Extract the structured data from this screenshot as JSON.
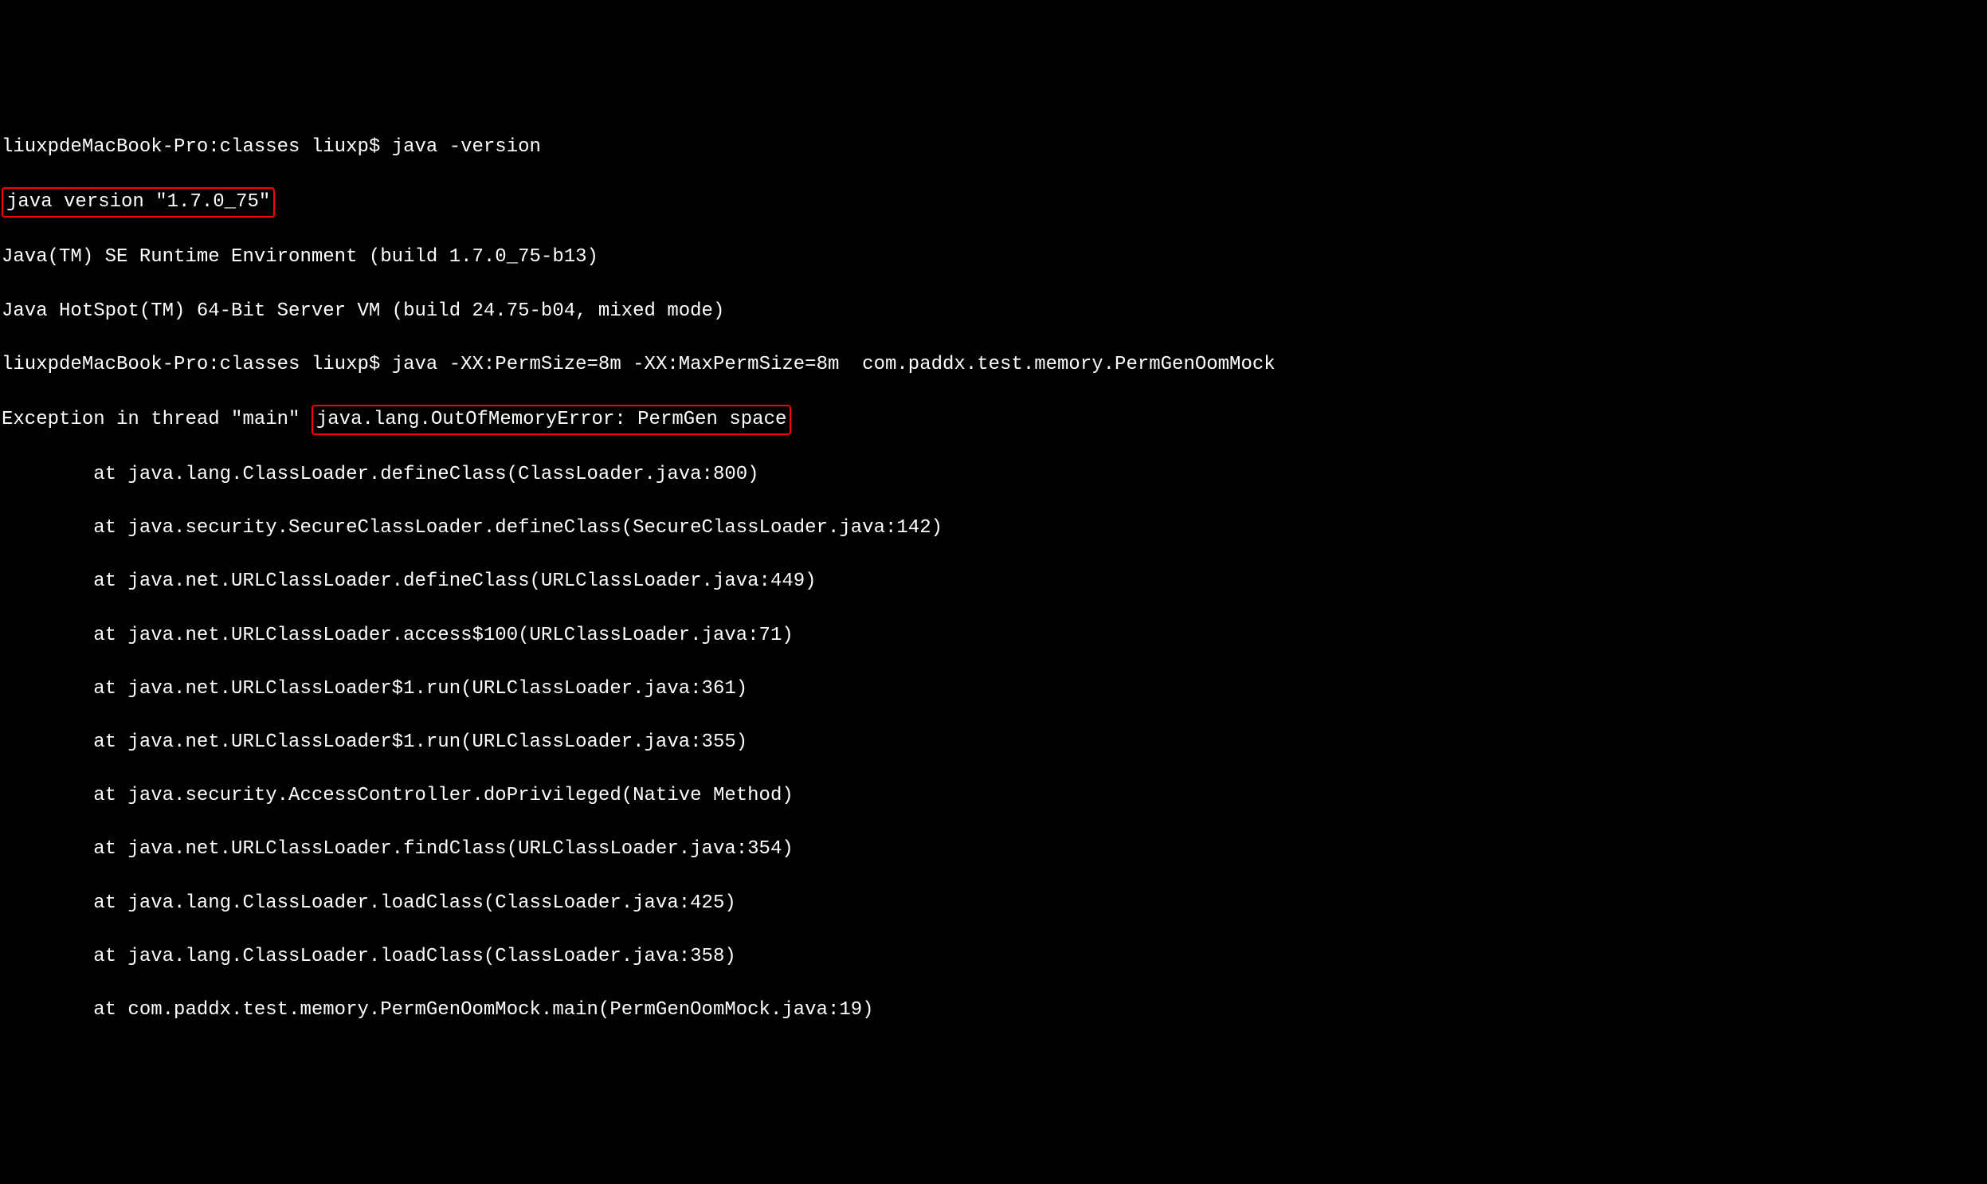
{
  "terminal": {
    "line1_prompt": "liuxpdeMacBook-Pro:classes liuxp$ ",
    "line1_cmd": "java -version",
    "line2_highlight": "java version \"1.7.0_75\"",
    "line3": "Java(TM) SE Runtime Environment (build 1.7.0_75-b13)",
    "line4": "Java HotSpot(TM) 64-Bit Server VM (build 24.75-b04, mixed mode)",
    "line5_prompt": "liuxpdeMacBook-Pro:classes liuxp$ ",
    "line5_cmd": "java -XX:PermSize=8m -XX:MaxPermSize=8m  com.paddx.test.memory.PermGenOomMock",
    "line6_prefix": "Exception in thread \"main\" ",
    "line6_highlight": "java.lang.OutOfMemoryError: PermGen space",
    "stack": [
      "at java.lang.ClassLoader.defineClass(ClassLoader.java:800)",
      "at java.security.SecureClassLoader.defineClass(SecureClassLoader.java:142)",
      "at java.net.URLClassLoader.defineClass(URLClassLoader.java:449)",
      "at java.net.URLClassLoader.access$100(URLClassLoader.java:71)",
      "at java.net.URLClassLoader$1.run(URLClassLoader.java:361)",
      "at java.net.URLClassLoader$1.run(URLClassLoader.java:355)",
      "at java.security.AccessController.doPrivileged(Native Method)",
      "at java.net.URLClassLoader.findClass(URLClassLoader.java:354)",
      "at java.lang.ClassLoader.loadClass(ClassLoader.java:425)",
      "at java.lang.ClassLoader.loadClass(ClassLoader.java:358)",
      "at com.paddx.test.memory.PermGenOomMock.main(PermGenOomMock.java:19)"
    ]
  }
}
